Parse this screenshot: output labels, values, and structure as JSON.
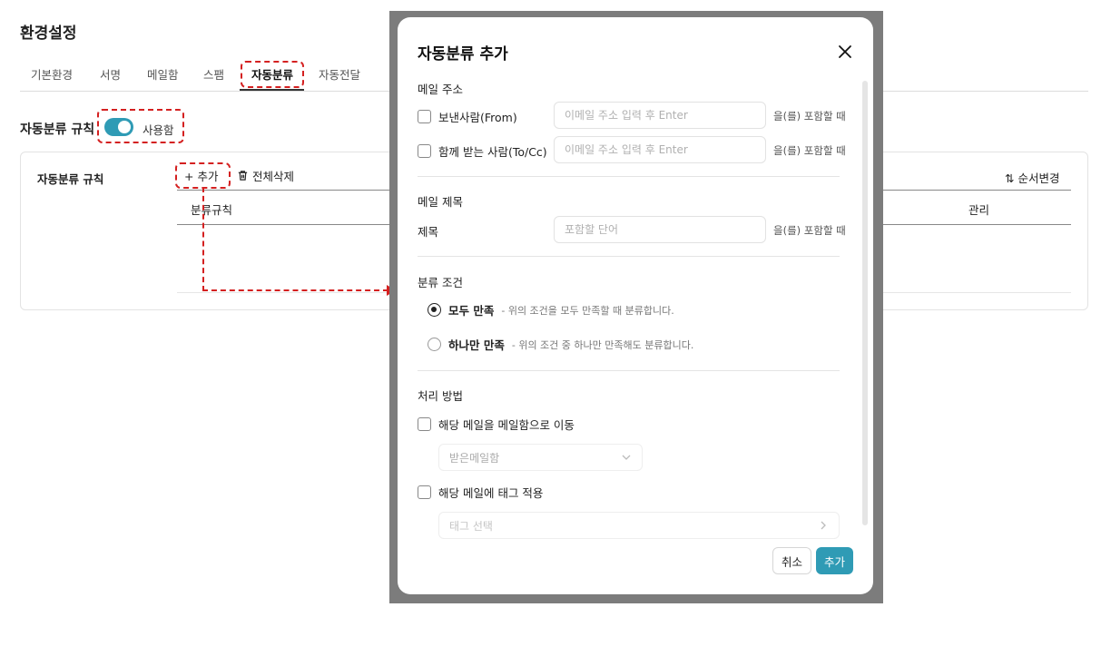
{
  "page_title": "환경설정",
  "tabs": [
    {
      "label": "기본환경"
    },
    {
      "label": "서명"
    },
    {
      "label": "메일함"
    },
    {
      "label": "스팸"
    },
    {
      "label": "자동분류"
    },
    {
      "label": "자동전달"
    }
  ],
  "rules_header": {
    "label": "자동분류 규칙",
    "toggle_label": "사용함"
  },
  "panel": {
    "label": "자동분류 규칙",
    "add": "+ 추가",
    "delete_all": "전체삭제",
    "reorder": "⇅ 순서변경",
    "col_rule": "분류규칙",
    "col_manage": "관리"
  },
  "modal": {
    "title": "자동분류 추가",
    "email_section": "메일 주소",
    "from_label": "보낸사람(From)",
    "from_placeholder": "이메일 주소 입력 후 Enter",
    "tocc_label": "함께 받는 사람(To/Cc)",
    "tocc_placeholder": "이메일 주소 입력 후 Enter",
    "contains_suffix": "을(를) 포함할 때",
    "subject_section": "메일 제목",
    "subject_label": "제목",
    "subject_placeholder": "포함할 단어",
    "condition_section": "분류 조건",
    "cond_all_label": "모두 만족",
    "cond_all_desc": "- 위의 조건을 모두 만족할 때 분류합니다.",
    "cond_any_label": "하나만 만족",
    "cond_any_desc": "- 위의 조건 중 하나만 만족해도 분류합니다.",
    "action_section": "처리 방법",
    "move_label": "해당 메일을 메일함으로 이동",
    "move_select": "받은메일함",
    "tag_label": "해당 메일에 태그 적용",
    "tag_select": "태그 선택",
    "cancel": "취소",
    "confirm": "추가"
  },
  "colors": {
    "accent": "#2f9bb5",
    "highlight": "#d42020",
    "overlay": "#7c7c7c"
  }
}
